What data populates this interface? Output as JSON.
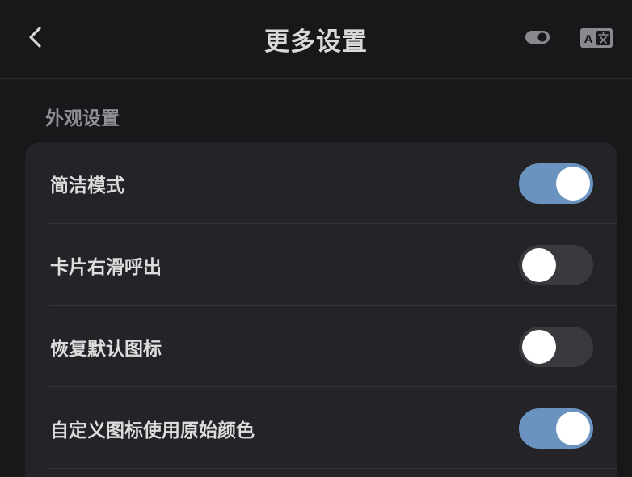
{
  "header": {
    "title": "更多设置",
    "back_icon": "chevron-left-icon",
    "theme_icon": "toggle-icon",
    "translate_icon": "translate-icon"
  },
  "section": {
    "title": "外观设置"
  },
  "settings": [
    {
      "label": "简洁模式",
      "enabled": true
    },
    {
      "label": "卡片右滑呼出",
      "enabled": false
    },
    {
      "label": "恢复默认图标",
      "enabled": false
    },
    {
      "label": "自定义图标使用原始颜色",
      "enabled": true
    }
  ],
  "colors": {
    "background": "#18181b",
    "card": "#232328",
    "switch_on": "#6b93c0",
    "switch_off": "#3a3a3e"
  }
}
